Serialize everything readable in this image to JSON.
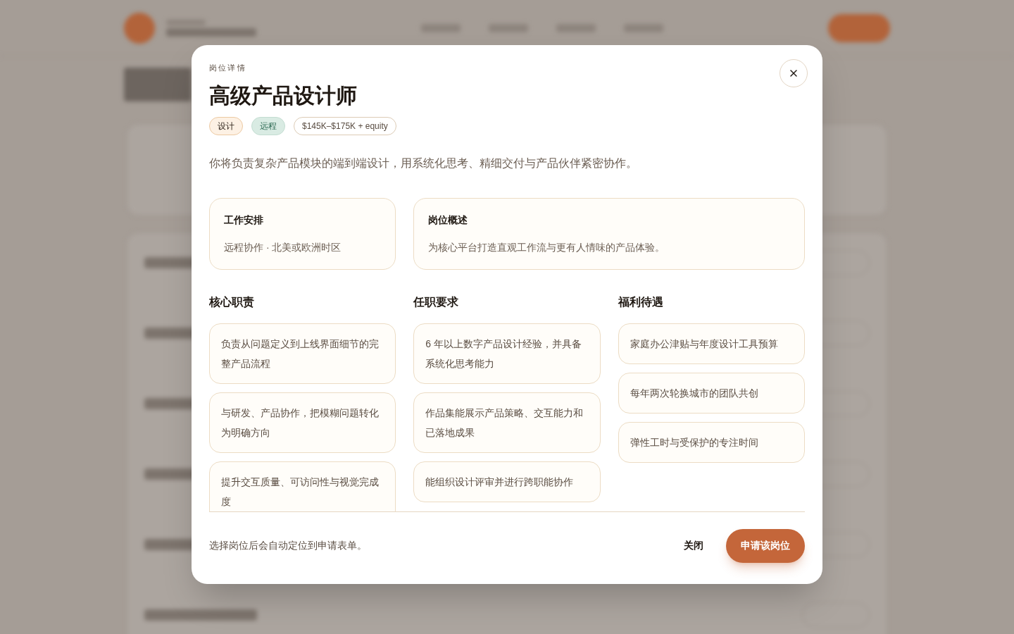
{
  "modal": {
    "eyebrow": "岗位详情",
    "title": "高级产品设计师",
    "tags": [
      {
        "label": "设计",
        "kind": "category"
      },
      {
        "label": "远程",
        "kind": "location"
      },
      {
        "label": "$145K–$175K + equity",
        "kind": "salary"
      }
    ],
    "summary": "你将负责复杂产品模块的端到端设计，用系统化思考、精细交付与产品伙伴紧密协作。",
    "info_cards": [
      {
        "heading": "工作安排",
        "text": "远程协作 · 北美或欧洲时区"
      },
      {
        "heading": "岗位概述",
        "text": "为核心平台打造直观工作流与更有人情味的产品体验。"
      }
    ],
    "sections": [
      {
        "heading": "核心职责",
        "items": [
          "负责从问题定义到上线界面细节的完整产品流程",
          "与研发、产品协作，把模糊问题转化为明确方向",
          "提升交互质量、可访问性与视觉完成度"
        ]
      },
      {
        "heading": "任职要求",
        "items": [
          "6 年以上数字产品设计经验，并具备系统化思考能力",
          "作品集能展示产品策略、交互能力和已落地成果",
          "能组织设计评审并进行跨职能协作"
        ]
      },
      {
        "heading": "福利待遇",
        "items": [
          "家庭办公津贴与年度设计工具预算",
          "每年两次轮换城市的团队共创",
          "弹性工时与受保护的专注时间"
        ]
      }
    ],
    "footer_note": "选择岗位后会自动定位到申请表单。",
    "close_label": "关闭",
    "apply_label": "申请该岗位"
  }
}
